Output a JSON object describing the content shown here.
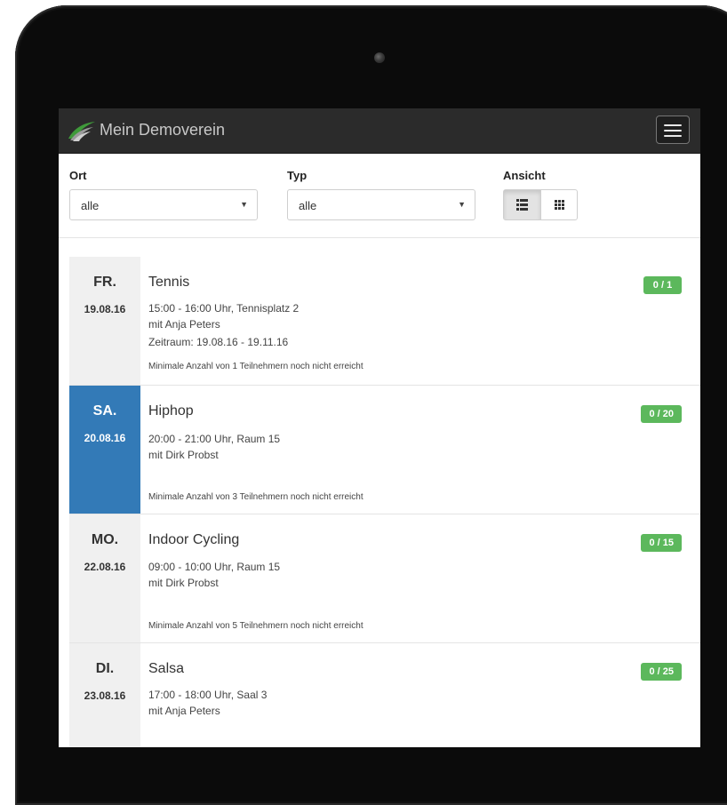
{
  "app": {
    "brand_name": "Mein Demoverein",
    "menu_icon": "hamburger-icon",
    "logo_icon": "swoosh-logo-icon"
  },
  "filters": {
    "ort_label": "Ort",
    "ort_value": "alle",
    "typ_label": "Typ",
    "typ_value": "alle",
    "ansicht_label": "Ansicht",
    "view_list_icon": "list-view-icon",
    "view_grid_icon": "grid-view-icon"
  },
  "colors": {
    "navbar": "#2b2b2b",
    "highlight": "#337ab7",
    "badge": "#5cb85c"
  },
  "events": [
    {
      "weekday": "FR.",
      "date": "19.08.16",
      "title": "Tennis",
      "time": "15:00 - 16:00 Uhr, Tennisplatz 2",
      "trainer": "mit Anja Peters",
      "period": "Zeitraum: 19.08.16 - 19.11.16",
      "note": "Minimale Anzahl von 1 Teilnehmern noch nicht erreicht",
      "badge": "0 / 1"
    },
    {
      "weekday": "SA.",
      "date": "20.08.16",
      "title": "Hiphop",
      "time": "20:00 - 21:00 Uhr, Raum 15",
      "trainer": "mit Dirk Probst",
      "note": "Minimale Anzahl von 3 Teilnehmern noch nicht erreicht",
      "badge": "0 / 20"
    },
    {
      "weekday": "MO.",
      "date": "22.08.16",
      "title": "Indoor Cycling",
      "time": "09:00 - 10:00 Uhr, Raum 15",
      "trainer": "mit Dirk Probst",
      "note": "Minimale Anzahl von 5 Teilnehmern noch nicht erreicht",
      "badge": "0 / 15"
    },
    {
      "weekday": "DI.",
      "date": "23.08.16",
      "title": "Salsa",
      "time": "17:00 - 18:00 Uhr, Saal 3",
      "trainer": "mit Anja Peters",
      "badge": "0 / 25"
    }
  ]
}
